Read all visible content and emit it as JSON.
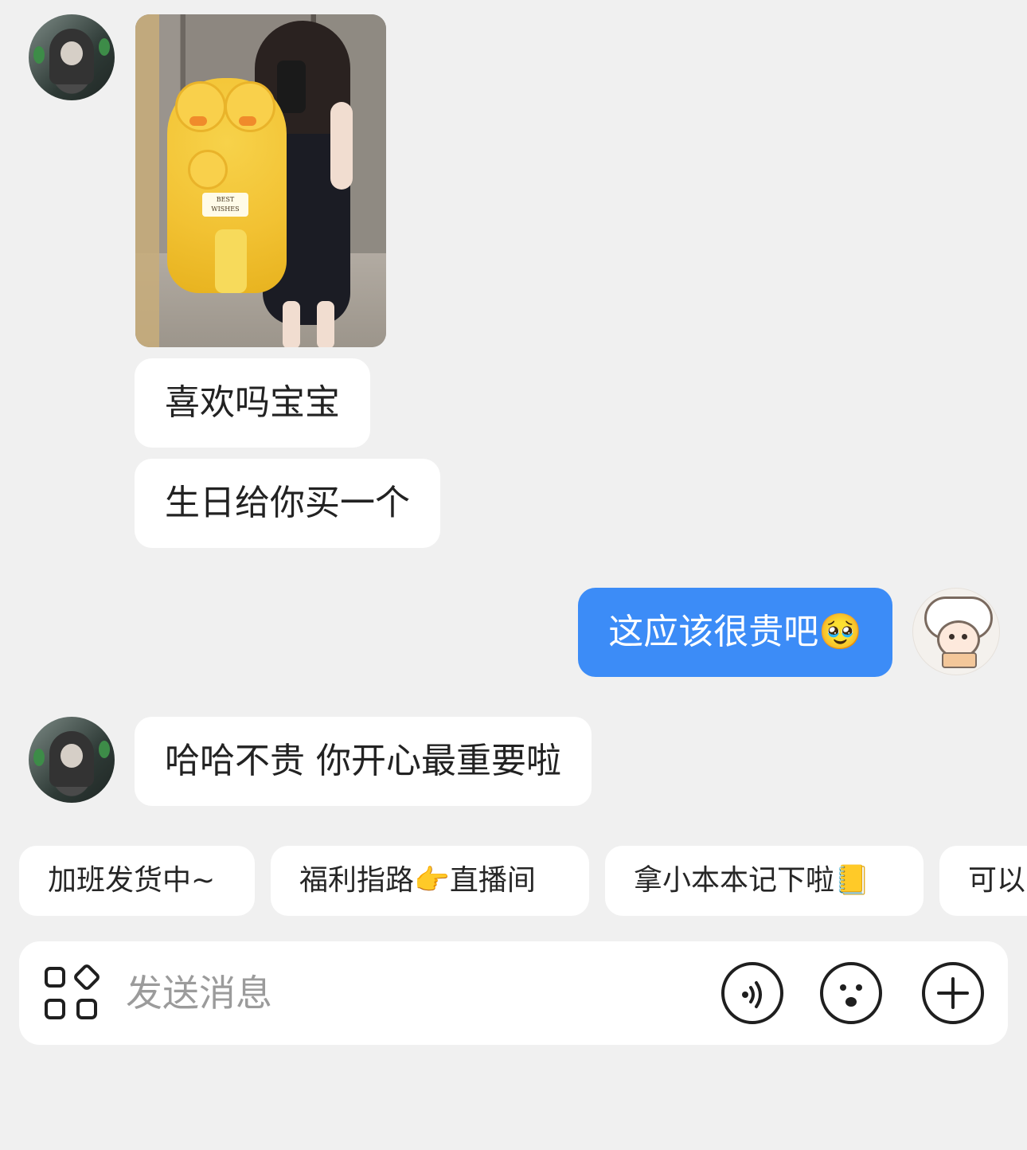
{
  "messages": [
    {
      "type": "image",
      "from": "friend",
      "image_caption": "BEST WISHES"
    },
    {
      "type": "text",
      "from": "friend",
      "text": "喜欢吗宝宝"
    },
    {
      "type": "text",
      "from": "friend",
      "text": "生日给你买一个"
    },
    {
      "type": "text",
      "from": "self",
      "text": "这应该很贵吧🥹"
    },
    {
      "type": "text",
      "from": "friend",
      "text": "哈哈不贵 你开心最重要啦"
    }
  ],
  "quick_replies": [
    "加班发货中~",
    "福利指路👉直播间",
    "拿小本本记下啦📒",
    "可以"
  ],
  "input": {
    "placeholder": "发送消息"
  },
  "icons": {
    "apps": "apps-grid-icon",
    "voice": "voice-icon",
    "emoji": "emoji-icon",
    "plus": "plus-icon"
  },
  "colors": {
    "background": "#f0f0f0",
    "incoming_bubble": "#ffffff",
    "outgoing_bubble": "#3c8cf7"
  }
}
